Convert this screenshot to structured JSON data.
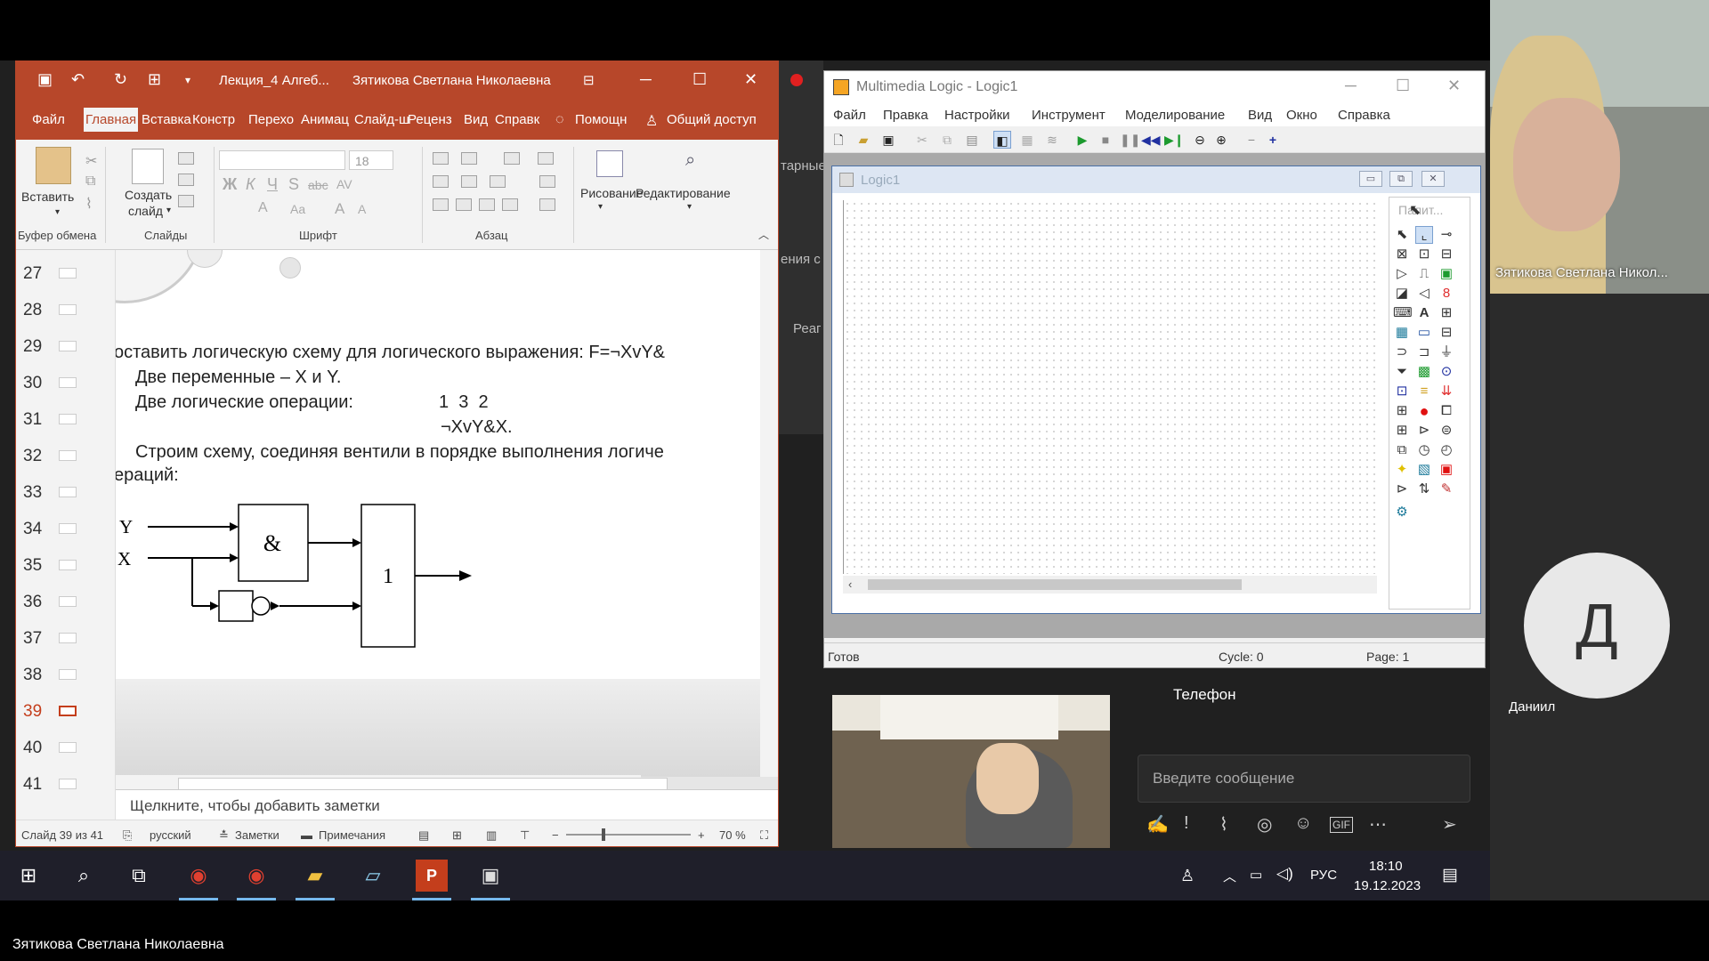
{
  "ppt": {
    "title": "Лекция_4 Алгеб...",
    "user": "Зятикова Светлана Николаевна",
    "tabs": [
      "Файл",
      "Главная",
      "Вставка",
      "Констр",
      "Перехо",
      "Анимац",
      "Слайд-ш",
      "Реценз",
      "Вид",
      "Справк",
      "Помощн",
      "Общий доступ"
    ],
    "ribbon": {
      "paste": "Вставить",
      "new_slide_1": "Создать",
      "new_slide_2": "слайд",
      "font_size": "18",
      "draw": "Рисование",
      "edit": "Редактирование",
      "groups": [
        "Буфер обмена",
        "Слайды",
        "Шрифт",
        "Абзац"
      ],
      "font_buttons": [
        "Ж",
        "К",
        "Ч",
        "S",
        "abc",
        "AV",
        "A",
        "Aa",
        "A",
        "A"
      ]
    },
    "slide_numbers": [
      "27",
      "28",
      "29",
      "30",
      "31",
      "32",
      "33",
      "34",
      "35",
      "36",
      "37",
      "38",
      "39",
      "40",
      "41"
    ],
    "slide": {
      "line1": "оставить логическую схему для логического выражения: F=¬XvY&",
      "line2": "Две переменные – X и Y.",
      "line3": "Две логические операции:",
      "ops_numbers": "1  3  2",
      "ops_expr": "¬XvY&X.",
      "line4": "Строим схему, соединяя вентили в порядке выполнения логиче",
      "line5": "ераций:",
      "var_y": "Y",
      "var_x": "X",
      "and_gate": "&",
      "or_gate": "1"
    },
    "notes_placeholder": "Щелкните, чтобы добавить заметки",
    "status": {
      "slide_info": "Слайд 39 из 41",
      "language": "русский",
      "notes": "Заметки",
      "comments": "Примечания",
      "zoom": "70 %"
    }
  },
  "behind_text": {
    "a": "тарные",
    "b": "ения с",
    "c": "Реаг"
  },
  "mml": {
    "title": "Multimedia Logic - Logic1",
    "menu": [
      "Файл",
      "Правка",
      "Настройки",
      "Инструмент",
      "Моделирование",
      "Вид",
      "Окно",
      "Справка"
    ],
    "child_title": "Logic1",
    "palette_title": "Палит...",
    "status_ready": "Готов",
    "status_cycle": "Cycle: 0",
    "status_page": "Page: 1"
  },
  "participants": {
    "host": "Зятикова Светлана Никол...",
    "avatar_letter": "Д",
    "avatar_name": "Даниил"
  },
  "chat": {
    "phone_label": "Телефон",
    "input_placeholder": "Введите сообщение",
    "gif": "GIF"
  },
  "taskbar": {
    "lang": "РУС",
    "time": "18:10",
    "date": "19.12.2023"
  },
  "bottom_name": "Зятикова Светлана Николаевна"
}
